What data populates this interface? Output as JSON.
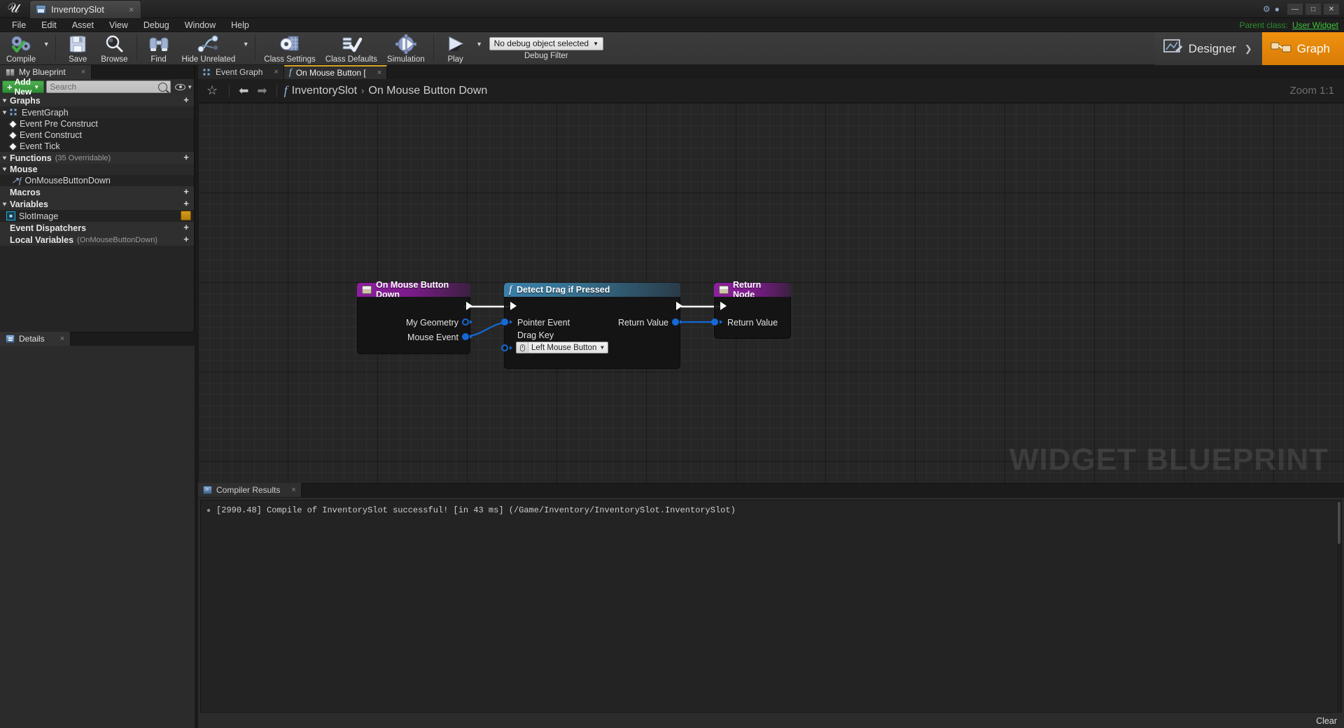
{
  "window": {
    "tab_title": "InventorySlot",
    "tab_close": "×",
    "minimize": "—",
    "maximize": "□",
    "close": "✕"
  },
  "menu": {
    "items": [
      "File",
      "Edit",
      "Asset",
      "View",
      "Debug",
      "Window",
      "Help"
    ],
    "parent_class_label": "Parent class:",
    "parent_class_value": "User Widget"
  },
  "toolbar": {
    "compile": "Compile",
    "save": "Save",
    "browse": "Browse",
    "find": "Find",
    "hide_unrelated": "Hide Unrelated",
    "class_settings": "Class Settings",
    "class_defaults": "Class Defaults",
    "simulation": "Simulation",
    "play": "Play",
    "debug_object": "No debug object selected",
    "debug_filter": "Debug Filter",
    "mode_designer": "Designer",
    "mode_graph": "Graph"
  },
  "my_blueprint": {
    "tab_label": "My Blueprint",
    "tab_close": "×",
    "add_new": "Add New",
    "search_placeholder": "Search",
    "search_value": "",
    "sections": [
      {
        "label": "Graphs",
        "kind": "section",
        "has_plus": true,
        "expanded": true
      },
      {
        "label": "EventGraph",
        "kind": "graph",
        "has_plus": false,
        "expanded": true
      },
      {
        "label": "Event Pre Construct",
        "kind": "event",
        "has_plus": false
      },
      {
        "label": "Event Construct",
        "kind": "event",
        "has_plus": false
      },
      {
        "label": "Event Tick",
        "kind": "event",
        "has_plus": false
      },
      {
        "label": "Functions",
        "sub": "(35 Overridable)",
        "kind": "section",
        "has_plus": true,
        "expanded": true
      },
      {
        "label": "Mouse",
        "kind": "subsection",
        "has_plus": false,
        "expanded": true
      },
      {
        "label": "OnMouseButtonDown",
        "kind": "function",
        "has_plus": false
      },
      {
        "label": "Macros",
        "kind": "section-flat",
        "has_plus": true
      },
      {
        "label": "Variables",
        "kind": "section",
        "has_plus": true,
        "expanded": true
      },
      {
        "label": "SlotImage",
        "kind": "variable",
        "has_edit": true
      },
      {
        "label": "Event Dispatchers",
        "kind": "section-flat",
        "has_plus": true
      },
      {
        "label": "Local Variables",
        "sub": "(OnMouseButtonDown)",
        "kind": "section-flat",
        "has_plus": true
      }
    ]
  },
  "details": {
    "tab_label": "Details",
    "tab_close": "×"
  },
  "graph_tabs": [
    {
      "label": "Event Graph",
      "icon": "graph-icon",
      "active": false,
      "close": "×"
    },
    {
      "label": "On Mouse Button [",
      "icon": "function-icon",
      "active": true,
      "close": "×"
    }
  ],
  "breadcrumb": {
    "root": "InventorySlot",
    "separator": "›",
    "current": "On Mouse Button Down",
    "zoom": "Zoom 1:1"
  },
  "canvas": {
    "watermark": "WIDGET BLUEPRINT"
  },
  "nodes": {
    "event_node": {
      "title": "On Mouse Button Down",
      "outputs": [
        {
          "label": "",
          "type": "exec"
        },
        {
          "label": "My Geometry",
          "type": "struct"
        },
        {
          "label": "Mouse Event",
          "type": "struct"
        }
      ]
    },
    "function_node": {
      "title": "Detect Drag if Pressed",
      "inputs": [
        {
          "label": "",
          "type": "exec"
        },
        {
          "label": "Pointer Event",
          "type": "struct"
        },
        {
          "label": "Drag Key",
          "type": "struct"
        }
      ],
      "outputs": [
        {
          "label": "",
          "type": "exec"
        },
        {
          "label": "Return Value",
          "type": "struct"
        }
      ],
      "drag_key_value": "Left Mouse Button"
    },
    "return_node": {
      "title": "Return Node",
      "inputs": [
        {
          "label": "",
          "type": "exec"
        },
        {
          "label": "Return Value",
          "type": "struct"
        }
      ]
    }
  },
  "compiler_results": {
    "tab_label": "Compiler Results",
    "tab_close": "×",
    "lines": [
      "[2990.48] Compile of InventorySlot successful! [in 43 ms] (/Game/Inventory/InventorySlot.InventorySlot)"
    ],
    "clear_label": "Clear"
  },
  "colors": {
    "accent_orange": "#f0920f",
    "event_purple": "#8e1fa0",
    "function_blue": "#3a7fa8",
    "pin_blue": "#1569d6",
    "add_new_green": "#4faf4f"
  }
}
